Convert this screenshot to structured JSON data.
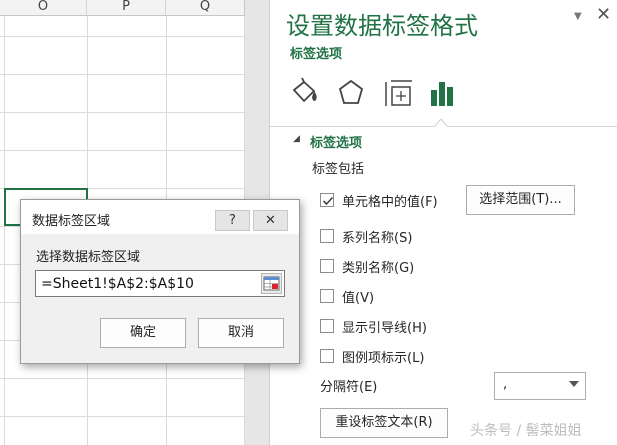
{
  "colors": {
    "accent": "#217346",
    "selection": "#217346"
  },
  "sheet": {
    "columns": [
      "O",
      "P",
      "Q"
    ]
  },
  "pane": {
    "title": "设置数据标签格式",
    "subtitle": "标签选项",
    "pin_icon": "dropdown-icon",
    "close_icon": "✕",
    "tabs": [
      {
        "icon": "fill-bucket-icon"
      },
      {
        "icon": "pentagon-icon"
      },
      {
        "icon": "size-properties-icon"
      },
      {
        "icon": "bar-chart-icon"
      }
    ],
    "section_title": "标签选项",
    "include_label": "标签包括",
    "options": [
      {
        "label": "单元格中的值(F)",
        "checked": true
      },
      {
        "label": "系列名称(S)",
        "checked": false
      },
      {
        "label": "类别名称(G)",
        "checked": false
      },
      {
        "label": "值(V)",
        "checked": false
      },
      {
        "label": "显示引导线(H)",
        "checked": false
      },
      {
        "label": "图例项标示(L)",
        "checked": false
      }
    ],
    "select_range_label": "选择范围(T)...",
    "separator_label": "分隔符(E)",
    "separator_value": ",",
    "reset_label": "重设标签文本(R)"
  },
  "dialog": {
    "title": "数据标签区域",
    "help_label": "?",
    "close_label": "✕",
    "prompt": "选择数据标签区域",
    "input_value": "=Sheet1!$A$2:$A$10",
    "ok_label": "确定",
    "cancel_label": "取消"
  },
  "watermark": "头条号 / 髻菜姐姐"
}
